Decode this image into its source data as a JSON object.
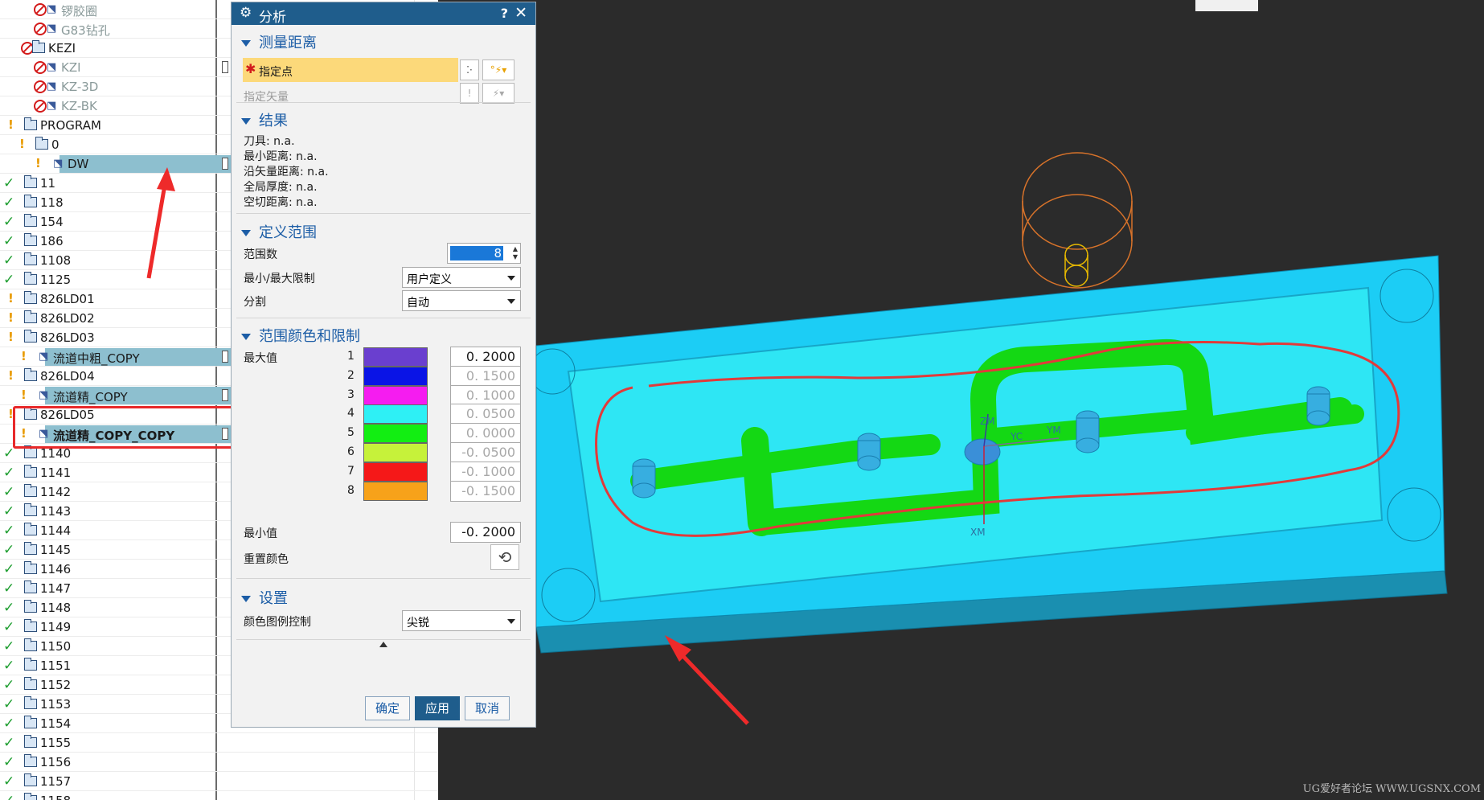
{
  "tree": {
    "rows": [
      {
        "label": "锣胶圈",
        "style": "grey"
      },
      {
        "label": "G83钻孔",
        "style": "grey"
      },
      {
        "label": "KEZI",
        "style": "normal"
      },
      {
        "label": "KZI",
        "style": "grey"
      },
      {
        "label": "KZ-3D",
        "style": "grey"
      },
      {
        "label": "KZ-BK",
        "style": "grey"
      },
      {
        "label": "PROGRAM",
        "style": "normal"
      },
      {
        "label": "0",
        "style": "normal"
      },
      {
        "label": "DW",
        "style": "normal"
      },
      {
        "label": "11",
        "style": "normal"
      },
      {
        "label": "118",
        "style": "normal"
      },
      {
        "label": "154",
        "style": "normal"
      },
      {
        "label": "186",
        "style": "normal"
      },
      {
        "label": "1108",
        "style": "normal"
      },
      {
        "label": "1125",
        "style": "normal"
      },
      {
        "label": "826LD01",
        "style": "normal"
      },
      {
        "label": "826LD02",
        "style": "normal"
      },
      {
        "label": "826LD03",
        "style": "normal"
      },
      {
        "label": "流道中粗_COPY",
        "style": "normal"
      },
      {
        "label": "826LD04",
        "style": "normal"
      },
      {
        "label": "流道精_COPY",
        "style": "normal"
      },
      {
        "label": "826LD05",
        "style": "normal"
      },
      {
        "label": "流道精_COPY_COPY",
        "style": "bold"
      },
      {
        "label": "1140",
        "style": "normal"
      },
      {
        "label": "1141",
        "style": "normal"
      },
      {
        "label": "1142",
        "style": "normal"
      },
      {
        "label": "1143",
        "style": "normal"
      },
      {
        "label": "1144",
        "style": "normal"
      },
      {
        "label": "1145",
        "style": "normal"
      },
      {
        "label": "1146",
        "style": "normal"
      },
      {
        "label": "1147",
        "style": "normal"
      },
      {
        "label": "1148",
        "style": "normal"
      },
      {
        "label": "1149",
        "style": "normal"
      },
      {
        "label": "1150",
        "style": "normal"
      },
      {
        "label": "1151",
        "style": "normal"
      },
      {
        "label": "1152",
        "style": "normal"
      },
      {
        "label": "1153",
        "style": "normal"
      },
      {
        "label": "1154",
        "style": "normal"
      },
      {
        "label": "1155",
        "style": "normal"
      },
      {
        "label": "1156",
        "style": "normal"
      },
      {
        "label": "1157",
        "style": "normal"
      },
      {
        "label": "1158",
        "style": "normal"
      }
    ]
  },
  "dialog": {
    "title": "分析",
    "help": "?",
    "close": "✕",
    "measure": {
      "heading": "测量距离",
      "specify_point": "指定点",
      "specify_vector": "指定矢量"
    },
    "results": {
      "heading": "结果",
      "lines": [
        "刀具: n.a.",
        "最小距离: n.a.",
        "沿矢量距离: n.a.",
        "全局厚度: n.a.",
        "空切距离: n.a."
      ]
    },
    "range": {
      "heading": "定义范围",
      "count_label": "范围数",
      "count_value": "8",
      "minmax_label": "最小/最大限制",
      "minmax_value": "用户定义",
      "split_label": "分割",
      "split_value": "自动"
    },
    "colors": {
      "heading": "范围颜色和限制",
      "max_label": "最大值",
      "min_label": "最小值",
      "reset_label": "重置颜色",
      "items": [
        {
          "index": "1",
          "color": "#6a3fcf",
          "limit": "0. 2000"
        },
        {
          "index": "2",
          "color": "#0a14e6",
          "limit": "0. 1500"
        },
        {
          "index": "3",
          "color": "#f51cf0",
          "limit": "0. 1000"
        },
        {
          "index": "4",
          "color": "#2ef0f5",
          "limit": "0. 0500"
        },
        {
          "index": "5",
          "color": "#12ee12",
          "limit": "0. 0000"
        },
        {
          "index": "6",
          "color": "#c6f23a",
          "limit": "-0. 0500"
        },
        {
          "index": "7",
          "color": "#f51818",
          "limit": "-0. 1000"
        },
        {
          "index": "8",
          "color": "#f7a21a",
          "limit": "-0. 1500"
        }
      ],
      "min_value": "-0. 2000"
    },
    "settings": {
      "heading": "设置",
      "legend_label": "颜色图例控制",
      "legend_value": "尖锐"
    },
    "buttons": {
      "ok": "确定",
      "apply": "应用",
      "cancel": "取消"
    }
  },
  "viewport": {
    "axis_labels": {
      "zm": "ZM",
      "yc": "YC",
      "ym": "YM",
      "xm": "XM"
    },
    "watermark": "UG爱好者论坛 WWW.UGSNX.COM"
  }
}
